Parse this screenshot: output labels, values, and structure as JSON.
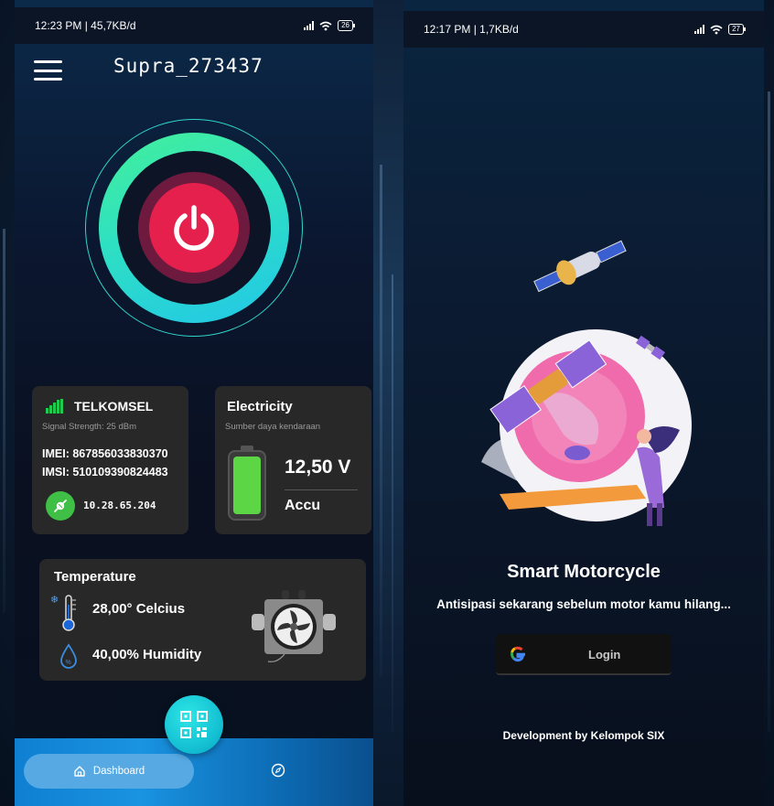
{
  "left_phone": {
    "status": {
      "time": "12:23 PM | 45,7KB/d",
      "battery": "26"
    },
    "header": {
      "title": "Supra_273437",
      "menu_icon": "hamburger-icon"
    },
    "power": {
      "icon": "power-icon"
    },
    "telkomsel": {
      "title": "TELKOMSEL",
      "signal": "Signal Strength: 25 dBm",
      "imei": "IMEI: 867856033830370",
      "imsi": "IMSI: 510109390824483",
      "ip": "10.28.65.204"
    },
    "electricity": {
      "title": "Electricity",
      "subtitle": "Sumber daya kendaraan",
      "voltage": "12,50 V",
      "source": "Accu"
    },
    "temperature": {
      "title": "Temperature",
      "temp": "28,00° Celcius",
      "humidity": "40,00% Humidity"
    },
    "nav": {
      "dashboard": "Dashboard"
    }
  },
  "right_phone": {
    "status": {
      "time": "12:17 PM | 1,7KB/d",
      "battery": "27"
    },
    "title": "Smart Motorcycle",
    "tagline": "Antisipasi sekarang sebelum motor kamu hilang...",
    "login": "Login",
    "footer": "Development by Kelompok SIX"
  },
  "colors": {
    "accent_green": "#44f09a",
    "accent_cyan": "#22c7e8",
    "power_red": "#e6204d",
    "card_bg": "#282828",
    "nav_blue": "#1a93e0"
  }
}
